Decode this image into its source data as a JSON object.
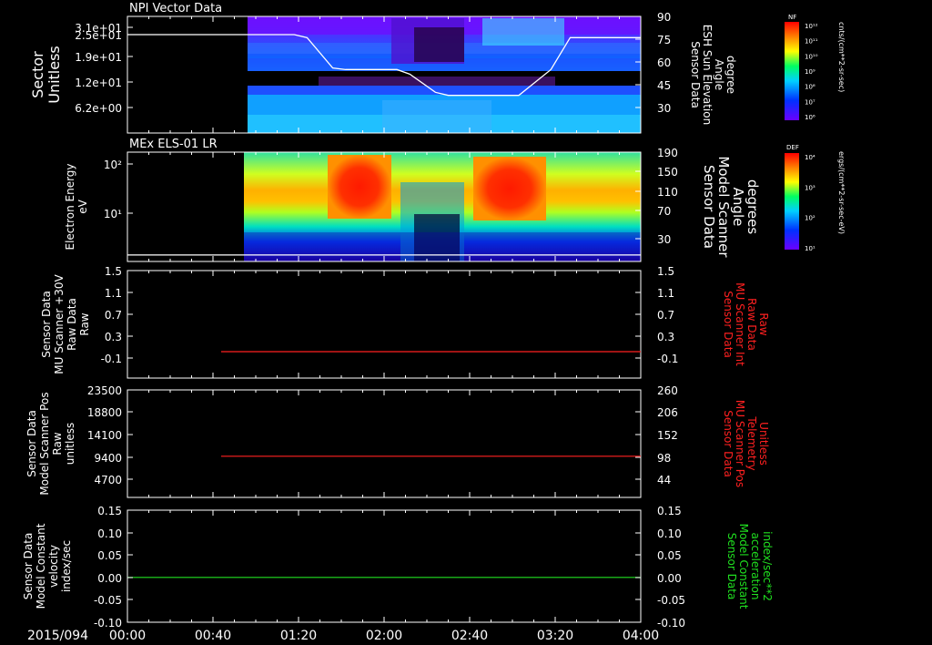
{
  "date_label": "2015/094",
  "time_ticks": [
    "00:00",
    "00:40",
    "01:20",
    "02:00",
    "02:40",
    "03:20",
    "04:00"
  ],
  "colors": {
    "background": "#000000",
    "axes": "#ffffff",
    "red": "#ff2020",
    "green": "#20e020"
  },
  "panel1": {
    "title": "NPI Vector Data",
    "left_label": [
      "Sector",
      "Unitless"
    ],
    "right_label": [
      "Sensor Data",
      "ESH Sun Elevation",
      "Angle",
      "degree"
    ],
    "left_ticks": [
      "3.1e+01",
      "2.5e+01",
      "1.9e+01",
      "1.2e+01",
      "6.2e+00"
    ],
    "right_ticks": [
      "90",
      "75",
      "60",
      "45",
      "30"
    ],
    "colorbar_tag": "NF",
    "colorbar_unit": "cnts/(cm**2-sr-sec)",
    "colorbar_ticks": [
      "10¹²",
      "10¹¹",
      "10¹⁰",
      "10⁹",
      "10⁸",
      "10⁷",
      "10⁶"
    ]
  },
  "panel2": {
    "title": "MEx ELS-01 LR",
    "left_label": [
      "Electron Energy",
      "eV"
    ],
    "right_label": [
      "Sensor Data",
      "Model Scanner",
      "Angle",
      "degrees"
    ],
    "left_ticks": [
      "10²",
      "10¹"
    ],
    "right_ticks": [
      "190",
      "150",
      "110",
      "70",
      "30"
    ],
    "colorbar_tag": "DEF",
    "colorbar_unit": "ergs/(cm**2-sr-sec-eV)",
    "colorbar_ticks": [
      "10⁴",
      "10³",
      "10²",
      "10¹"
    ]
  },
  "panel3": {
    "left_label": [
      "Sensor Data",
      "MU Scanner +30V",
      "Raw Data",
      "Raw"
    ],
    "right_label": [
      "Sensor Data",
      "MU Scanner Int",
      "Raw Data",
      "Raw"
    ],
    "left_ticks": [
      "1.5",
      "1.1",
      "0.7",
      "0.3",
      "-0.1"
    ],
    "right_ticks": [
      "1.5",
      "1.1",
      "0.7",
      "0.3",
      "-0.1"
    ]
  },
  "panel4": {
    "left_label": [
      "Sensor Data",
      "Model Scanner Pos",
      "Raw",
      "unitless"
    ],
    "right_label": [
      "Sensor Data",
      "MU Scanner Pos",
      "Telemetry",
      "Unitless"
    ],
    "left_ticks": [
      "23500",
      "18800",
      "14100",
      "9400",
      "4700"
    ],
    "right_ticks": [
      "260",
      "206",
      "152",
      "98",
      "44"
    ]
  },
  "panel5": {
    "left_label": [
      "Sensor Data",
      "Model Constant",
      "velocity",
      "index/sec"
    ],
    "right_label": [
      "Sensor Data",
      "Model Constant",
      "acceleration",
      "index/sec**2"
    ],
    "left_ticks": [
      "0.15",
      "0.10",
      "0.05",
      "0.00",
      "-0.05",
      "-0.10"
    ],
    "right_ticks": [
      "0.15",
      "0.10",
      "0.05",
      "0.00",
      "-0.05",
      "-0.10"
    ]
  },
  "chart_data": [
    {
      "type": "heatmap",
      "panel": "NPI Vector Data",
      "x_range_hours": [
        0,
        4
      ],
      "data_start_hour": 0.8,
      "y_range": [
        0,
        31
      ],
      "line_series": {
        "name": "ESH Sun Elevation Angle",
        "x_hours": [
          0,
          0.8,
          1.3,
          1.4,
          1.6,
          1.7,
          2.1,
          2.2,
          2.4,
          2.5,
          3.05,
          3.3,
          3.45,
          4.0
        ],
        "y_deg": [
          78,
          78,
          78,
          76,
          56,
          55,
          55,
          52,
          40,
          38,
          38,
          55,
          76,
          76
        ]
      }
    },
    {
      "type": "heatmap",
      "panel": "MEx ELS-01 LR",
      "x_range_hours": [
        0,
        4
      ],
      "data_start_hour": 0.77,
      "yscale": "log",
      "line_series": {
        "name": "Model Scanner Angle",
        "x_hours": [
          0,
          4
        ],
        "y_deg": [
          10,
          10
        ]
      }
    },
    {
      "type": "line",
      "panel": "MU Scanner",
      "x_hours": [
        0.73,
        4.0
      ],
      "y": [
        -0.1,
        -0.1
      ],
      "ylim": [
        -0.1,
        1.5
      ],
      "color": "#ff2020"
    },
    {
      "type": "line",
      "panel": "Scanner Pos",
      "x_hours": [
        0.73,
        4.0
      ],
      "y": [
        9000,
        9000
      ],
      "ylim": [
        0,
        23500
      ],
      "color": "#ff2020"
    },
    {
      "type": "line",
      "panel": "Model Constant",
      "x_hours": [
        0,
        4.0
      ],
      "y": [
        0.0,
        0.0
      ],
      "ylim": [
        -0.1,
        0.15
      ],
      "color": "#20e020"
    }
  ]
}
